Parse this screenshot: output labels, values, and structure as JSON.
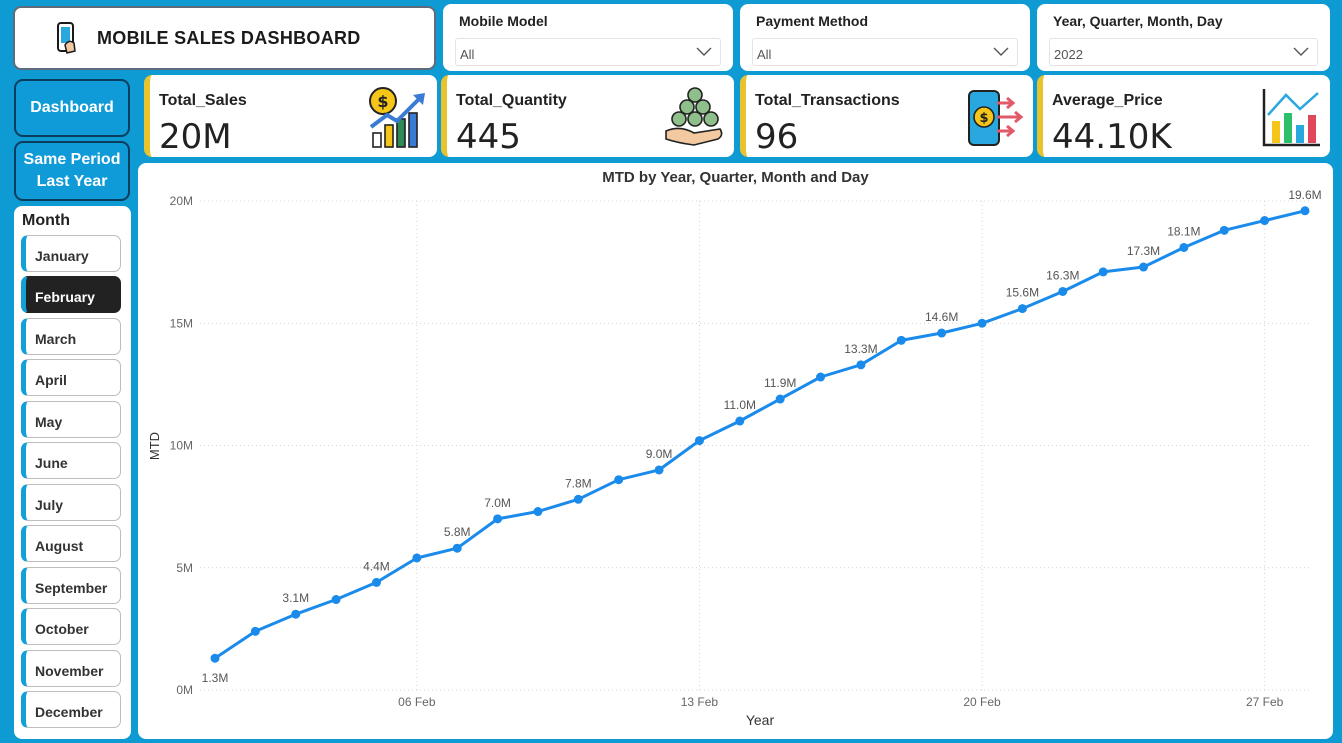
{
  "header": {
    "title": "MOBILE SALES DASHBOARD",
    "icon": "phone-icon"
  },
  "slicers": [
    {
      "label": "Mobile Model",
      "value": "All"
    },
    {
      "label": "Payment Method",
      "value": "All"
    },
    {
      "label": "Year, Quarter, Month, Day",
      "value": "2022"
    }
  ],
  "nav": {
    "dashboard": "Dashboard",
    "same_period": "Same Period Last Year"
  },
  "months": {
    "label": "Month",
    "items": [
      "January",
      "February",
      "March",
      "April",
      "May",
      "June",
      "July",
      "August",
      "September",
      "October",
      "November",
      "December"
    ],
    "selected": "February"
  },
  "kpis": [
    {
      "label": "Total_Sales",
      "value": "20M",
      "icon": "money-growth-icon"
    },
    {
      "label": "Total_Quantity",
      "value": "445",
      "icon": "coins-hand-icon"
    },
    {
      "label": "Total_Transactions",
      "value": "96",
      "icon": "phone-payment-icon"
    },
    {
      "label": "Average_Price",
      "value": "44.10K",
      "icon": "bar-chart-icon"
    }
  ],
  "colors": {
    "accent": "#0e9bd4",
    "line": "#1a8bea",
    "kpi_bar": "#e8c32e"
  },
  "chart_data": {
    "type": "line",
    "title": "MTD by Year, Quarter, Month and Day",
    "xlabel": "Year",
    "ylabel": "MTD",
    "ylim": [
      0,
      20
    ],
    "y_unit": "M",
    "yticks": [
      "0M",
      "5M",
      "10M",
      "15M",
      "20M"
    ],
    "xtick_labels": [
      "06 Feb",
      "13 Feb",
      "20 Feb",
      "27 Feb"
    ],
    "x": [
      1,
      2,
      3,
      4,
      5,
      6,
      7,
      8,
      9,
      10,
      11,
      12,
      13,
      14,
      15,
      16,
      17,
      18,
      19,
      20,
      21,
      22,
      23,
      24,
      25,
      26,
      27,
      28
    ],
    "series": [
      {
        "values": [
          1.3,
          2.4,
          3.1,
          3.7,
          4.4,
          5.4,
          5.8,
          7.0,
          7.3,
          7.8,
          8.6,
          9.0,
          10.2,
          11.0,
          11.9,
          12.8,
          13.3,
          14.3,
          14.6,
          15.0,
          15.6,
          16.3,
          17.1,
          17.3,
          18.1,
          18.8,
          19.2,
          19.6
        ]
      }
    ],
    "data_labels": [
      {
        "x": 1,
        "text": "1.3M"
      },
      {
        "x": 3,
        "text": "3.1M"
      },
      {
        "x": 5,
        "text": "4.4M"
      },
      {
        "x": 7,
        "text": "5.8M"
      },
      {
        "x": 8,
        "text": "7.0M"
      },
      {
        "x": 10,
        "text": "7.8M"
      },
      {
        "x": 12,
        "text": "9.0M"
      },
      {
        "x": 14,
        "text": "11.0M"
      },
      {
        "x": 15,
        "text": "11.9M"
      },
      {
        "x": 17,
        "text": "13.3M"
      },
      {
        "x": 19,
        "text": "14.6M"
      },
      {
        "x": 21,
        "text": "15.6M"
      },
      {
        "x": 22,
        "text": "16.3M"
      },
      {
        "x": 24,
        "text": "17.3M"
      },
      {
        "x": 25,
        "text": "18.1M"
      },
      {
        "x": 28,
        "text": "19.6M"
      }
    ],
    "grid": true
  }
}
